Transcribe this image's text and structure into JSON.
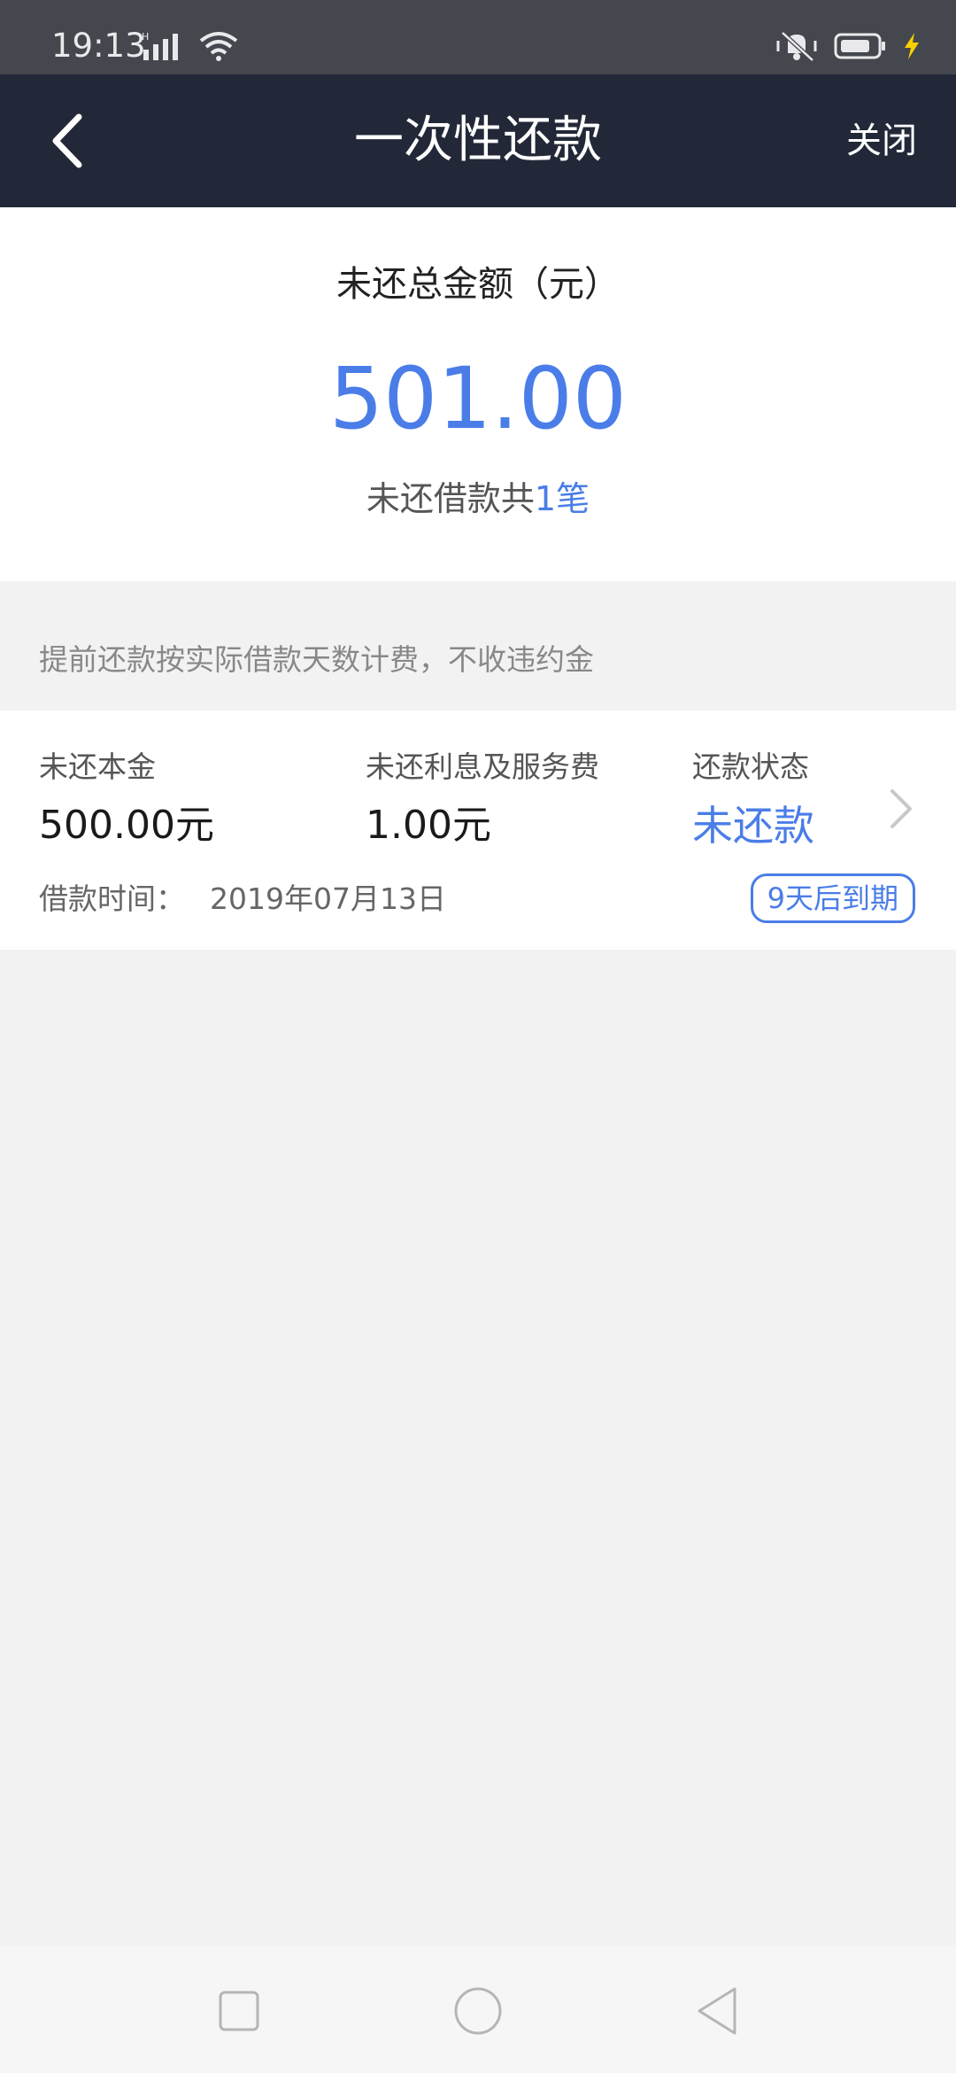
{
  "status_bar": {
    "time": "19:13",
    "icons": [
      "signal-icon",
      "wifi-icon",
      "vibrate-mute-icon",
      "battery-icon",
      "charging-icon"
    ]
  },
  "nav": {
    "title": "一次性还款",
    "close_label": "关闭",
    "colors": {
      "background": "#232838",
      "text": "#ffffff"
    }
  },
  "summary": {
    "label": "未还总金额（元）",
    "amount": "501.00",
    "count_prefix": "未还借款共",
    "count_number": "1",
    "count_suffix": "笔"
  },
  "notice": "提前还款按实际借款天数计费，不收违约金",
  "loan": {
    "principal_label": "未还本金",
    "principal_value": "500.00元",
    "interest_label": "未还利息及服务费",
    "interest_value": "1.00元",
    "status_label": "还款状态",
    "status_value": "未还款",
    "date_label": "借款时间：",
    "date_value": "2019年07月13日",
    "due_badge": "9天后到期"
  },
  "colors": {
    "accent": "#4a7de8",
    "page_background": "#f2f2f2"
  }
}
